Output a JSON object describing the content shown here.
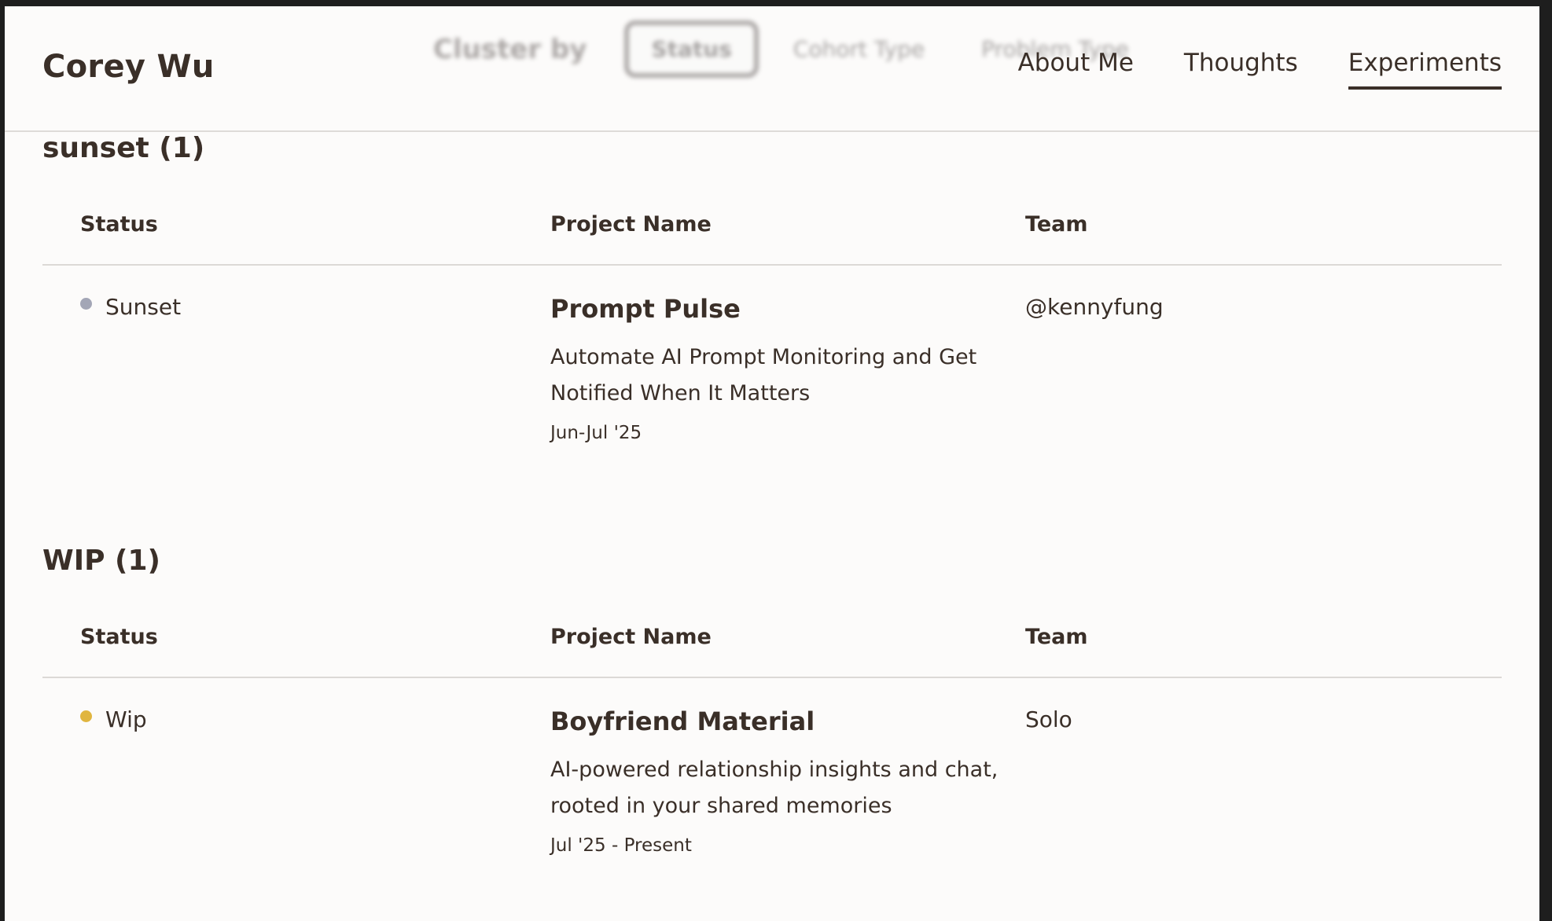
{
  "brand": "Corey Wu",
  "cluster": {
    "label": "Cluster by",
    "options": [
      "Status",
      "Cohort Type",
      "Problem Type"
    ],
    "selected": "Status"
  },
  "nav": {
    "items": [
      {
        "label": "About Me",
        "active": false
      },
      {
        "label": "Thoughts",
        "active": false
      },
      {
        "label": "Experiments",
        "active": true
      }
    ]
  },
  "table_headers": {
    "status": "Status",
    "name": "Project Name",
    "team": "Team"
  },
  "groups": [
    {
      "title": "sunset (1)",
      "rows": [
        {
          "status": "Sunset",
          "status_color": "#a3a6b6",
          "name": "Prompt Pulse",
          "description": "Automate AI Prompt Monitoring and Get Notified When It Matters",
          "date": "Jun-Jul '25",
          "team": "@kennyfung"
        }
      ]
    },
    {
      "title": "WIP (1)",
      "rows": [
        {
          "status": "Wip",
          "status_color": "#e0b53f",
          "name": "Boyfriend Material",
          "description": "AI-powered relationship insights and chat, rooted in your shared memories",
          "date": "Jul '25 - Present",
          "team": "Solo"
        }
      ]
    }
  ]
}
